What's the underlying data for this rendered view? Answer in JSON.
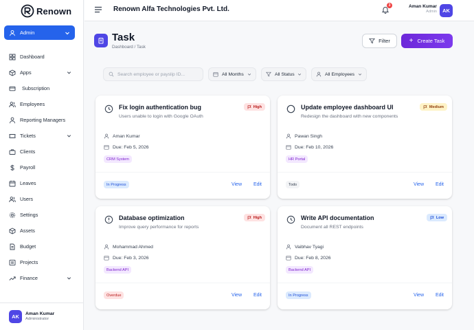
{
  "brand": {
    "name": "Renown"
  },
  "sidebar": {
    "role_label": "Admin",
    "items": [
      {
        "label": "Dashboard",
        "icon": "grid-icon",
        "has_chevron": false
      },
      {
        "label": "Apps",
        "icon": "cube-icon",
        "has_chevron": true
      },
      {
        "label": "Subscription",
        "icon": "card-icon",
        "has_chevron": false
      },
      {
        "label": "Employees",
        "icon": "users-icon",
        "has_chevron": false
      },
      {
        "label": "Reporting Managers",
        "icon": "user-tie-icon",
        "has_chevron": false
      },
      {
        "label": "Tickets",
        "icon": "ticket-icon",
        "has_chevron": true
      },
      {
        "label": "Clients",
        "icon": "briefcase-icon",
        "has_chevron": false
      },
      {
        "label": "Payroll",
        "icon": "dollar-icon",
        "has_chevron": false
      },
      {
        "label": "Leaves",
        "icon": "calendar-icon",
        "has_chevron": false
      },
      {
        "label": "Users",
        "icon": "users-icon",
        "has_chevron": false
      },
      {
        "label": "Settings",
        "icon": "gear-icon",
        "has_chevron": false
      },
      {
        "label": "Assets",
        "icon": "box-icon",
        "has_chevron": false
      },
      {
        "label": "Budget",
        "icon": "document-icon",
        "has_chevron": false
      },
      {
        "label": "Projects",
        "icon": "folder-icon",
        "has_chevron": false
      },
      {
        "label": "Finance",
        "icon": "trend-icon",
        "has_chevron": true
      }
    ],
    "user": {
      "initials": "AK",
      "name": "Aman Kumar",
      "role": "Administrator"
    }
  },
  "header": {
    "company": "Renown Alfa Technologies Pvt. Ltd.",
    "notification_count": "3",
    "user": {
      "name": "Aman Kumar",
      "role": "Admin",
      "initials": "AK"
    }
  },
  "page": {
    "title": "Task",
    "breadcrumb": "Dashboard / Task",
    "filter_label": "Filter",
    "create_label": "Create Task"
  },
  "filters": {
    "search_placeholder": "Search employee or payslip ID...",
    "months": "All Months",
    "status": "All Status",
    "employees": "All Employees"
  },
  "tasks": [
    {
      "title": "Fix login authentication bug",
      "description": "Users unable to login with Google OAuth",
      "priority": "High",
      "assignee": "Aman Kumar",
      "due": "Due: Feb 5, 2026",
      "tag": "CRM System",
      "status": "In Progress",
      "view_label": "View",
      "edit_label": "Edit"
    },
    {
      "title": "Update employee dashboard UI",
      "description": "Redesign the dashboard with new components",
      "priority": "Medium",
      "assignee": "Pawan Singh",
      "due": "Due: Feb 10, 2026",
      "tag": "HR Portal",
      "status": "Todo",
      "view_label": "View",
      "edit_label": "Edit"
    },
    {
      "title": "Database optimization",
      "description": "Improve query performance for reports",
      "priority": "High",
      "assignee": "Mohammad Ahmed",
      "due": "Due: Feb 3, 2026",
      "tag": "Backend API",
      "status": "Overdue",
      "view_label": "View",
      "edit_label": "Edit"
    },
    {
      "title": "Write API documentation",
      "description": "Document all REST endpoints",
      "priority": "Low",
      "assignee": "Vaibhav Tyagi",
      "due": "Due: Feb 8, 2026",
      "tag": "Backend API",
      "status": "In Progress",
      "view_label": "View",
      "edit_label": "Edit"
    }
  ],
  "colors": {
    "primary": "#2563eb",
    "accent": "#7c3aed",
    "avatar": "#4f46e5"
  }
}
